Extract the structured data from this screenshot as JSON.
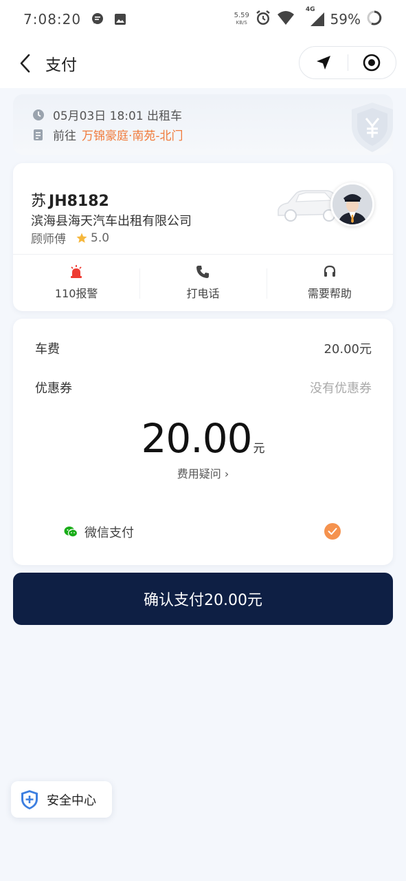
{
  "status_bar": {
    "time": "7:08:20",
    "net_speed_value": "5.59",
    "net_speed_unit": "KB/S",
    "network_type": "4G",
    "battery": "59%"
  },
  "header": {
    "title": "支付",
    "icons": [
      "back-arrow-icon",
      "navigation-arrow-icon",
      "record-target-icon"
    ]
  },
  "trip": {
    "datetime": "05月03日 18:01 出租车",
    "dest_prefix": "前往",
    "destination": "万锦豪庭·南苑-北门"
  },
  "driver": {
    "plate_region": "苏",
    "plate_number": "JH8182",
    "company": "滨海县海天汽车出租有限公司",
    "name": "顾师傅",
    "rating": "5.0",
    "actions": [
      {
        "label": "110报警",
        "icon": "police-light-icon"
      },
      {
        "label": "打电话",
        "icon": "phone-icon"
      },
      {
        "label": "需要帮助",
        "icon": "headset-icon"
      }
    ]
  },
  "fee": {
    "fare_label": "车费",
    "fare_value": "20.00元",
    "coupon_label": "优惠券",
    "coupon_value": "没有优惠券",
    "total_amount": "20.00",
    "total_unit": "元",
    "question": "费用疑问 ›",
    "pay_method": "微信支付",
    "pay_selected": true
  },
  "confirm_label": "确认支付20.00元",
  "safety_label": "安全中心",
  "colors": {
    "accent_orange": "#f07a3a",
    "confirm_bg": "#0e1f44",
    "wechat_green": "#1aad19",
    "shield_blue": "#3d7fe0"
  }
}
